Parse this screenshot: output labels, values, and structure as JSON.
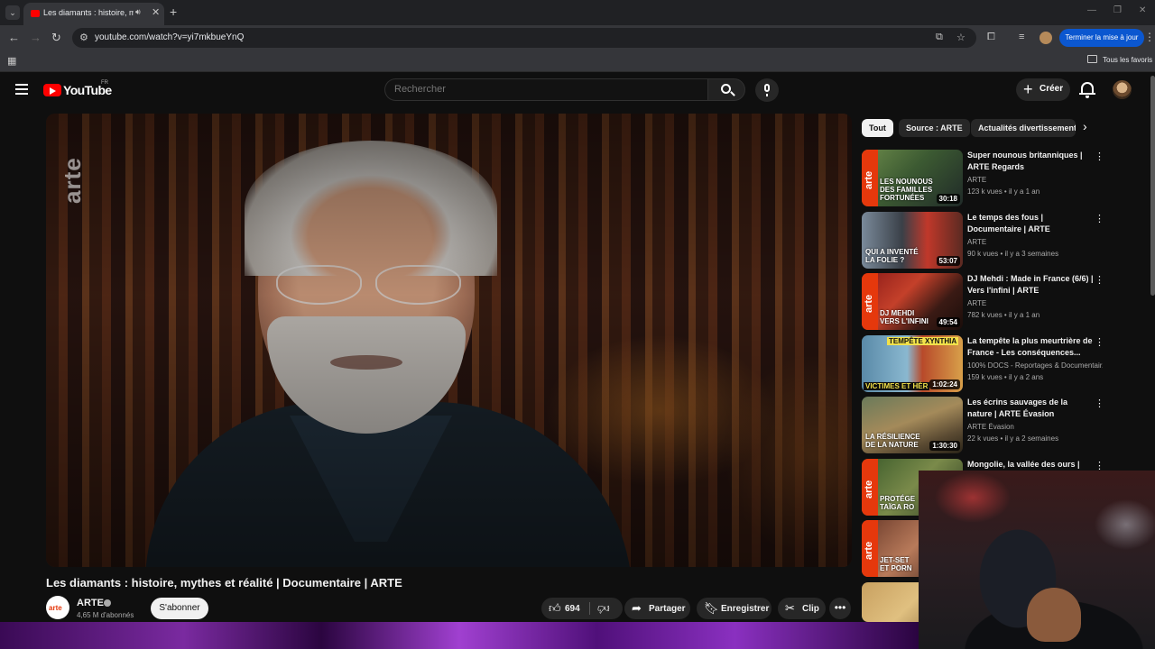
{
  "browser": {
    "tab_title": "Les diamants : histoire, myth",
    "url": "youtube.com/watch?v=yi7mkbueYnQ",
    "update_button": "Terminer la mise à jour",
    "all_bookmarks": "Tous les favoris"
  },
  "header": {
    "logo_text": "YouTube",
    "region": "FR",
    "search_placeholder": "Rechercher",
    "create_label": "Créer"
  },
  "video": {
    "watermark": "arte",
    "title": "Les diamants : histoire, mythes et réalité | Documentaire | ARTE",
    "channel": "ARTE",
    "channel_avatar_text": "arte",
    "subscribers": "4,65 M d'abonnés",
    "subscribe_label": "S'abonner",
    "likes": "694",
    "share_label": "Partager",
    "save_label": "Enregistrer",
    "clip_label": "Clip"
  },
  "chips": [
    "Tout",
    "Source : ARTE",
    "Actualités divertissement"
  ],
  "recommendations": [
    {
      "title": "Super nounous britanniques | ARTE Regards",
      "channel": "ARTE",
      "meta": "123 k vues • il y a 1 an",
      "duration": "30:18",
      "thumb_text": "LES NOUNOUS\nDES FAMILLES\nFORTUNÉES"
    },
    {
      "title": "Le temps des fous | Documentaire | ARTE",
      "channel": "ARTE",
      "meta": "90 k vues • il y a 3 semaines",
      "duration": "53:07",
      "thumb_text": "QUI A INVENTÉ\nLA FOLIE ?"
    },
    {
      "title": "DJ Mehdi : Made in France (6/6) | Vers l'infini | ARTE",
      "channel": "ARTE",
      "meta": "782 k vues • il y a 1 an",
      "duration": "49:54",
      "thumb_text": "DJ MEHDI\nVERS L'INFINI"
    },
    {
      "title": "La tempête la plus meurtrière de France - Les conséquences...",
      "channel": "100% DOCS - Reportages & Documentair...",
      "meta": "159 k vues • il y a 2 ans",
      "duration": "1:02:24",
      "thumb_text": "VICTIMES ET HÉR"
    },
    {
      "title": "Les écrins sauvages de la nature | ARTE Évasion",
      "channel": "ARTE Évasion",
      "meta": "22 k vues • il y a 2 semaines",
      "duration": "1:30:30",
      "thumb_text": "LA RÉSILIENCE\nDE LA NATURE"
    },
    {
      "title": "Mongolie, la vallée des ours |",
      "channel": "",
      "meta": "",
      "duration": "",
      "thumb_text": "PROTÉGE\nTAÏGA RO"
    },
    {
      "title": "",
      "channel": "",
      "meta": "",
      "duration": "",
      "thumb_text": "JET-SET\nET PORN"
    }
  ],
  "thumb_labels": {
    "tempete_banner": "TEMPÊTE XYNTHIA",
    "arte_band": "arte"
  },
  "colors": {
    "youtube_red": "#ff0000",
    "arte_orange": "#e5380c",
    "update_blue": "#0b57d0"
  }
}
